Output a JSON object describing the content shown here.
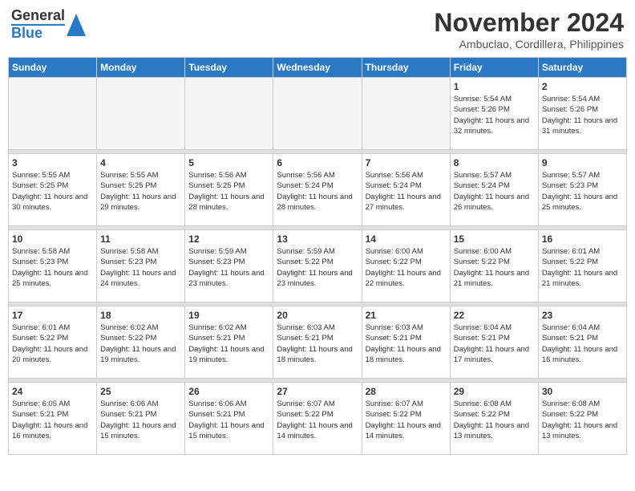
{
  "header": {
    "logo_general": "General",
    "logo_blue": "Blue",
    "month": "November 2024",
    "location": "Ambuclao, Cordillera, Philippines"
  },
  "days_of_week": [
    "Sunday",
    "Monday",
    "Tuesday",
    "Wednesday",
    "Thursday",
    "Friday",
    "Saturday"
  ],
  "weeks": [
    {
      "days": [
        {
          "date": "",
          "empty": true
        },
        {
          "date": "",
          "empty": true
        },
        {
          "date": "",
          "empty": true
        },
        {
          "date": "",
          "empty": true
        },
        {
          "date": "",
          "empty": true
        },
        {
          "date": "1",
          "sunrise": "Sunrise: 5:54 AM",
          "sunset": "Sunset: 5:26 PM",
          "daylight": "Daylight: 11 hours and 32 minutes."
        },
        {
          "date": "2",
          "sunrise": "Sunrise: 5:54 AM",
          "sunset": "Sunset: 5:26 PM",
          "daylight": "Daylight: 11 hours and 31 minutes."
        }
      ]
    },
    {
      "days": [
        {
          "date": "3",
          "sunrise": "Sunrise: 5:55 AM",
          "sunset": "Sunset: 5:25 PM",
          "daylight": "Daylight: 11 hours and 30 minutes."
        },
        {
          "date": "4",
          "sunrise": "Sunrise: 5:55 AM",
          "sunset": "Sunset: 5:25 PM",
          "daylight": "Daylight: 11 hours and 29 minutes."
        },
        {
          "date": "5",
          "sunrise": "Sunrise: 5:56 AM",
          "sunset": "Sunset: 5:25 PM",
          "daylight": "Daylight: 11 hours and 28 minutes."
        },
        {
          "date": "6",
          "sunrise": "Sunrise: 5:56 AM",
          "sunset": "Sunset: 5:24 PM",
          "daylight": "Daylight: 11 hours and 28 minutes."
        },
        {
          "date": "7",
          "sunrise": "Sunrise: 5:56 AM",
          "sunset": "Sunset: 5:24 PM",
          "daylight": "Daylight: 11 hours and 27 minutes."
        },
        {
          "date": "8",
          "sunrise": "Sunrise: 5:57 AM",
          "sunset": "Sunset: 5:24 PM",
          "daylight": "Daylight: 11 hours and 26 minutes."
        },
        {
          "date": "9",
          "sunrise": "Sunrise: 5:57 AM",
          "sunset": "Sunset: 5:23 PM",
          "daylight": "Daylight: 11 hours and 25 minutes."
        }
      ]
    },
    {
      "days": [
        {
          "date": "10",
          "sunrise": "Sunrise: 5:58 AM",
          "sunset": "Sunset: 5:23 PM",
          "daylight": "Daylight: 11 hours and 25 minutes."
        },
        {
          "date": "11",
          "sunrise": "Sunrise: 5:58 AM",
          "sunset": "Sunset: 5:23 PM",
          "daylight": "Daylight: 11 hours and 24 minutes."
        },
        {
          "date": "12",
          "sunrise": "Sunrise: 5:59 AM",
          "sunset": "Sunset: 5:23 PM",
          "daylight": "Daylight: 11 hours and 23 minutes."
        },
        {
          "date": "13",
          "sunrise": "Sunrise: 5:59 AM",
          "sunset": "Sunset: 5:22 PM",
          "daylight": "Daylight: 11 hours and 23 minutes."
        },
        {
          "date": "14",
          "sunrise": "Sunrise: 6:00 AM",
          "sunset": "Sunset: 5:22 PM",
          "daylight": "Daylight: 11 hours and 22 minutes."
        },
        {
          "date": "15",
          "sunrise": "Sunrise: 6:00 AM",
          "sunset": "Sunset: 5:22 PM",
          "daylight": "Daylight: 11 hours and 21 minutes."
        },
        {
          "date": "16",
          "sunrise": "Sunrise: 6:01 AM",
          "sunset": "Sunset: 5:22 PM",
          "daylight": "Daylight: 11 hours and 21 minutes."
        }
      ]
    },
    {
      "days": [
        {
          "date": "17",
          "sunrise": "Sunrise: 6:01 AM",
          "sunset": "Sunset: 5:22 PM",
          "daylight": "Daylight: 11 hours and 20 minutes."
        },
        {
          "date": "18",
          "sunrise": "Sunrise: 6:02 AM",
          "sunset": "Sunset: 5:22 PM",
          "daylight": "Daylight: 11 hours and 19 minutes."
        },
        {
          "date": "19",
          "sunrise": "Sunrise: 6:02 AM",
          "sunset": "Sunset: 5:21 PM",
          "daylight": "Daylight: 11 hours and 19 minutes."
        },
        {
          "date": "20",
          "sunrise": "Sunrise: 6:03 AM",
          "sunset": "Sunset: 5:21 PM",
          "daylight": "Daylight: 11 hours and 18 minutes."
        },
        {
          "date": "21",
          "sunrise": "Sunrise: 6:03 AM",
          "sunset": "Sunset: 5:21 PM",
          "daylight": "Daylight: 11 hours and 18 minutes."
        },
        {
          "date": "22",
          "sunrise": "Sunrise: 6:04 AM",
          "sunset": "Sunset: 5:21 PM",
          "daylight": "Daylight: 11 hours and 17 minutes."
        },
        {
          "date": "23",
          "sunrise": "Sunrise: 6:04 AM",
          "sunset": "Sunset: 5:21 PM",
          "daylight": "Daylight: 11 hours and 16 minutes."
        }
      ]
    },
    {
      "days": [
        {
          "date": "24",
          "sunrise": "Sunrise: 6:05 AM",
          "sunset": "Sunset: 5:21 PM",
          "daylight": "Daylight: 11 hours and 16 minutes."
        },
        {
          "date": "25",
          "sunrise": "Sunrise: 6:06 AM",
          "sunset": "Sunset: 5:21 PM",
          "daylight": "Daylight: 11 hours and 15 minutes."
        },
        {
          "date": "26",
          "sunrise": "Sunrise: 6:06 AM",
          "sunset": "Sunset: 5:21 PM",
          "daylight": "Daylight: 11 hours and 15 minutes."
        },
        {
          "date": "27",
          "sunrise": "Sunrise: 6:07 AM",
          "sunset": "Sunset: 5:22 PM",
          "daylight": "Daylight: 11 hours and 14 minutes."
        },
        {
          "date": "28",
          "sunrise": "Sunrise: 6:07 AM",
          "sunset": "Sunset: 5:22 PM",
          "daylight": "Daylight: 11 hours and 14 minutes."
        },
        {
          "date": "29",
          "sunrise": "Sunrise: 6:08 AM",
          "sunset": "Sunset: 5:22 PM",
          "daylight": "Daylight: 11 hours and 13 minutes."
        },
        {
          "date": "30",
          "sunrise": "Sunrise: 6:08 AM",
          "sunset": "Sunset: 5:22 PM",
          "daylight": "Daylight: 11 hours and 13 minutes."
        }
      ]
    }
  ]
}
